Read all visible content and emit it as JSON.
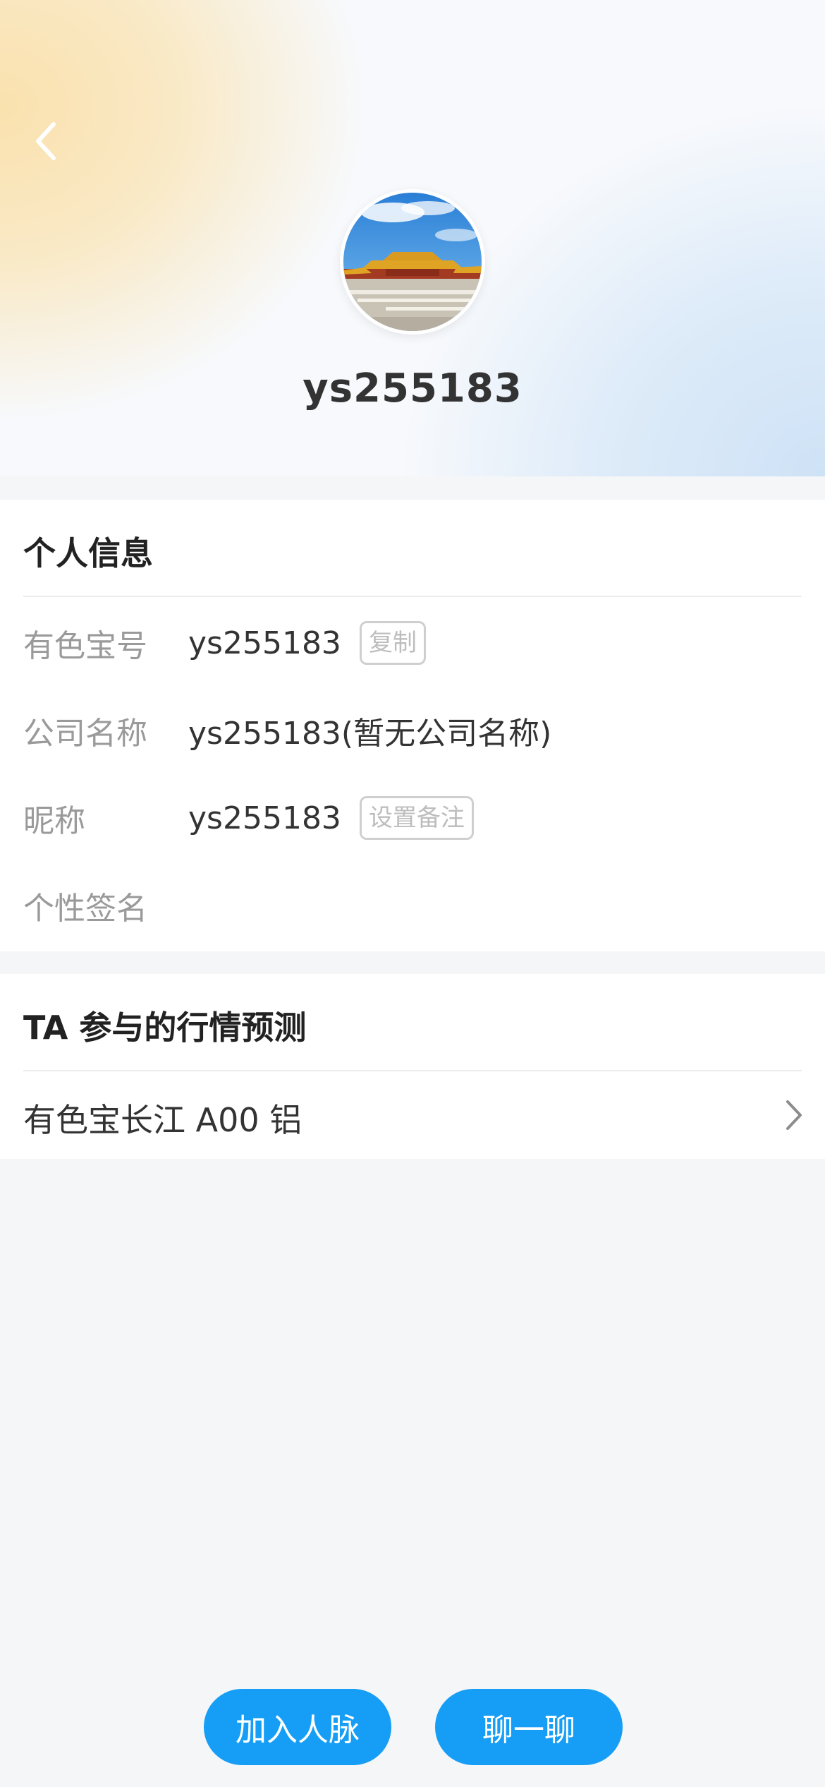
{
  "header": {
    "back_icon": "chevron-left-icon",
    "username": "ys255183"
  },
  "personal_info": {
    "title": "个人信息",
    "rows": [
      {
        "label": "有色宝号",
        "value": "ys255183",
        "action": "复制"
      },
      {
        "label": "公司名称",
        "value": "ys255183(暂无公司名称)"
      },
      {
        "label": "昵称",
        "value": "ys255183",
        "action": "设置备注"
      },
      {
        "label": "个性签名",
        "value": ""
      }
    ]
  },
  "predictions": {
    "title": "TA 参与的行情预测",
    "items": [
      {
        "label": "有色宝长江 A00 铝"
      }
    ]
  },
  "actions": {
    "add_contact": "加入人脉",
    "chat": "聊一聊"
  },
  "colors": {
    "accent": "#169ef6",
    "label_gray": "#9a9a9a",
    "text": "#333333"
  }
}
